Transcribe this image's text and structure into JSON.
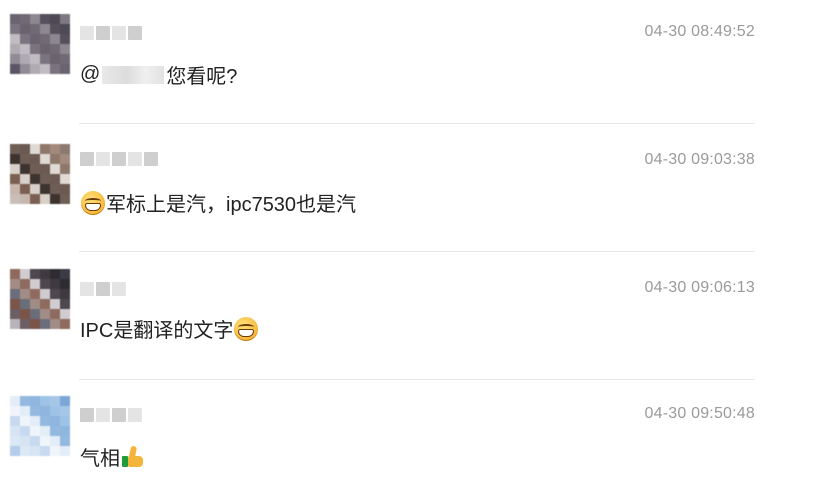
{
  "comments": [
    {
      "time": "04-30 08:49:52",
      "text_prefix": "@",
      "text_suffix": "您看呢?",
      "avatar_colors": [
        "#6b6470",
        "#5c5664",
        "#8d8790",
        "#b0abb2",
        "#4e4a55",
        "#7a7480",
        "#a39ea6",
        "#6f6a74",
        "#908b94",
        "#55505b",
        "#c1bcc3",
        "#7e7883"
      ]
    },
    {
      "time": "04-30 09:03:38",
      "text": "军标上是汽，ipc7530也是汽",
      "avatar_colors": [
        "#8a7a70",
        "#6f5e55",
        "#c9bfb8",
        "#e0d9d4",
        "#7b5f52",
        "#a48a7c",
        "#3d3430",
        "#b19a8e",
        "#6a5a51",
        "#c7b6ab",
        "#8e786c",
        "#d8cfc9"
      ]
    },
    {
      "time": "04-30 09:06:13",
      "text": "IPC是翻译的文字",
      "avatar_colors": [
        "#6a6d7a",
        "#3c3a44",
        "#8e6b5e",
        "#b9b4b9",
        "#4e4750",
        "#7b5548",
        "#2e2c33",
        "#a28d86",
        "#5a5560",
        "#d0ccd0",
        "#6b5e64",
        "#3f3a40"
      ]
    },
    {
      "time": "04-30 09:50:48",
      "text": "气相",
      "avatar_colors": [
        "#9ec3e6",
        "#c7daf0",
        "#7aa7d6",
        "#e3edf7",
        "#b3cdea",
        "#8fb6df",
        "#d6e4f4",
        "#a6c6e8",
        "#f0f5fb",
        "#c0d5ee",
        "#93b9e0",
        "#dbe8f5"
      ]
    }
  ]
}
